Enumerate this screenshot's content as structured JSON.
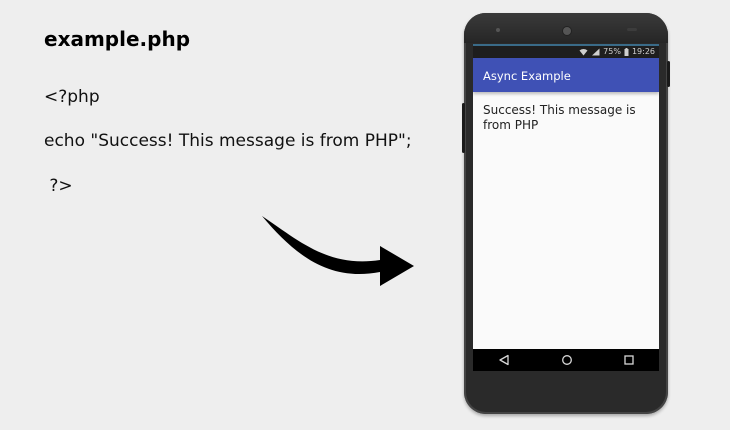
{
  "code": {
    "filename": "example.php",
    "lines": [
      "<?php",
      "echo \"Success! This message is from PHP\";",
      " ?>"
    ]
  },
  "phone": {
    "status_bar": {
      "battery": "75%",
      "time": "19:26"
    },
    "app_bar": {
      "title": "Async Example",
      "color": "#3f51b5"
    },
    "content": {
      "message": "Success! This message is from PHP"
    },
    "nav_bar": {
      "icons": [
        "back-icon",
        "home-icon",
        "recents-icon"
      ]
    }
  }
}
